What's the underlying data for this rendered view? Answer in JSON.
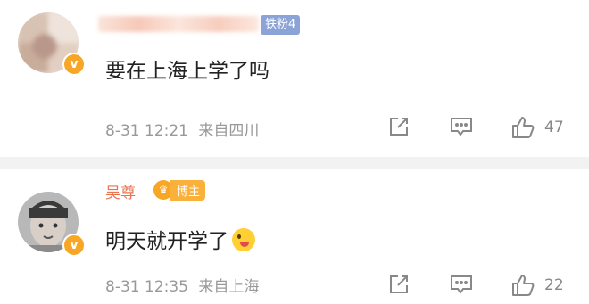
{
  "comments": [
    {
      "badge": "铁粉4",
      "verified_mark": "v",
      "text": "要在上海上学了吗",
      "date": "8-31",
      "time": "12:21",
      "location": "来自四川",
      "likes": "47"
    },
    {
      "username": "吴尊",
      "badge": "博主",
      "verified_mark": "v",
      "text": "明天就开学了",
      "emoji": "grinning-tongue-emoji",
      "date": "8-31",
      "time": "12:35",
      "location": "来自上海",
      "likes": "22"
    }
  ],
  "icons": {
    "share": "share-icon",
    "reply": "comment-icon",
    "like": "thumbs-up-icon"
  },
  "colors": {
    "username": "#eb7350",
    "fan_badge": "#8ba3d6",
    "host_badge": "#f9b13c",
    "meta_text": "#999999",
    "divider": "#f2f2f2"
  }
}
